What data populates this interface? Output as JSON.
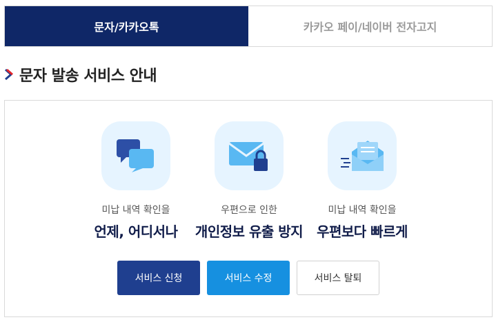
{
  "tabs": [
    {
      "label": "문자/카카오톡",
      "active": true
    },
    {
      "label": "카카오 페이/네이버 전자고지",
      "active": false
    }
  ],
  "section": {
    "title": "문자 발송 서비스 안내"
  },
  "features": [
    {
      "icon": "chat-bubbles-icon",
      "sub": "미납 내역 확인을",
      "main": "언제, 어디서나"
    },
    {
      "icon": "locked-envelope-icon",
      "sub": "우편으로 인한",
      "main": "개인정보 유출 방지"
    },
    {
      "icon": "fast-mail-icon",
      "sub": "미납 내역 확인을",
      "main": "우편보다 빠르게"
    }
  ],
  "buttons": {
    "apply": "서비스 신청",
    "edit": "서비스 수정",
    "cancel": "서비스 탈퇴"
  },
  "colors": {
    "active_tab": "#0f2767",
    "apply_button": "#1f3f8f",
    "edit_button": "#1690e0",
    "icon_bg": "#e6f4ff"
  }
}
